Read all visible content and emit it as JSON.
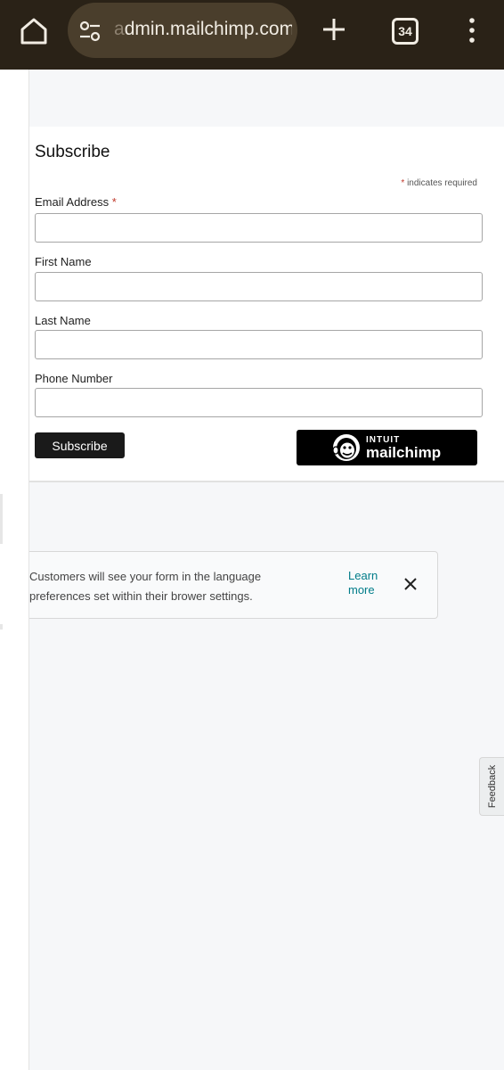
{
  "browser": {
    "url_fragment_faded": "a",
    "url": "dmin.mailchimp.com",
    "tab_count": "34"
  },
  "form": {
    "title": "Subscribe",
    "required_note": "indicates required",
    "asterisk": "*",
    "fields": [
      {
        "label": "Email Address",
        "required": true,
        "value": ""
      },
      {
        "label": "First Name",
        "required": false,
        "value": ""
      },
      {
        "label": "Last Name",
        "required": false,
        "value": ""
      },
      {
        "label": "Phone Number",
        "required": false,
        "value": ""
      }
    ],
    "submit_label": "Subscribe",
    "badge": {
      "line1": "INTUIT",
      "line2": "mailchimp"
    }
  },
  "banner": {
    "text": "Customers will see your form in the language preferences set within their brower settings.",
    "link": "Learn more"
  },
  "feedback_label": "Feedback",
  "colors": {
    "chrome_bg": "#2a2217",
    "urlbar_bg": "#4a3e2c",
    "link": "#007c89",
    "required": "#c0392b",
    "button": "#1a1a1a"
  }
}
